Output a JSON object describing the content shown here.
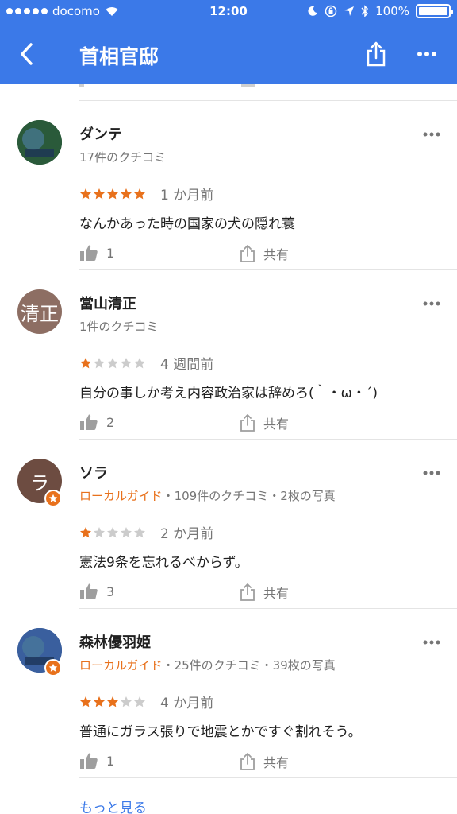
{
  "status_bar": {
    "carrier": "docomo",
    "time": "12:00",
    "battery": "100%",
    "battery_level": 1.0
  },
  "header": {
    "title": "首相官邸"
  },
  "reviews": [
    {
      "name": "ダンテ",
      "guide_label": "",
      "meta": "17件のクチコミ",
      "rating": 5,
      "when": "1 か月前",
      "text": "なんかあった時の国家の犬の隠れ蓑",
      "likes": "1",
      "share": "共有",
      "avatar_initial": "",
      "avatar_color": "#2a5a3a"
    },
    {
      "name": "當山清正",
      "guide_label": "",
      "meta": "1件のクチコミ",
      "rating": 1,
      "when": "4 週間前",
      "text": "自分の事しか考え内容政治家は辞めろ(｀・ω・´)",
      "likes": "2",
      "share": "共有",
      "avatar_initial": "清正",
      "avatar_color": "#8d6e63"
    },
    {
      "name": "ソラ",
      "guide_label": "ローカルガイド",
      "meta": "・109件のクチコミ・2枚の写真",
      "rating": 1,
      "when": "2 か月前",
      "text": "憲法9条を忘れるべからず。",
      "likes": "3",
      "share": "共有",
      "avatar_initial": "ラ",
      "avatar_color": "#6d4c41"
    },
    {
      "name": "森林優羽姫",
      "guide_label": "ローカルガイド",
      "meta": "・25件のクチコミ・39枚の写真",
      "rating": 3,
      "when": "4 か月前",
      "text": "普通にガラス張りで地震とかですぐ割れそう。",
      "likes": "1",
      "share": "共有",
      "avatar_initial": "",
      "avatar_color": "#3a5f9e"
    }
  ],
  "more_link": "もっと見る",
  "colors": {
    "header": "#3b79e8",
    "star_on": "#e8711c",
    "star_off": "#cccccc",
    "guide": "#e8711c",
    "link": "#3b79e8"
  }
}
